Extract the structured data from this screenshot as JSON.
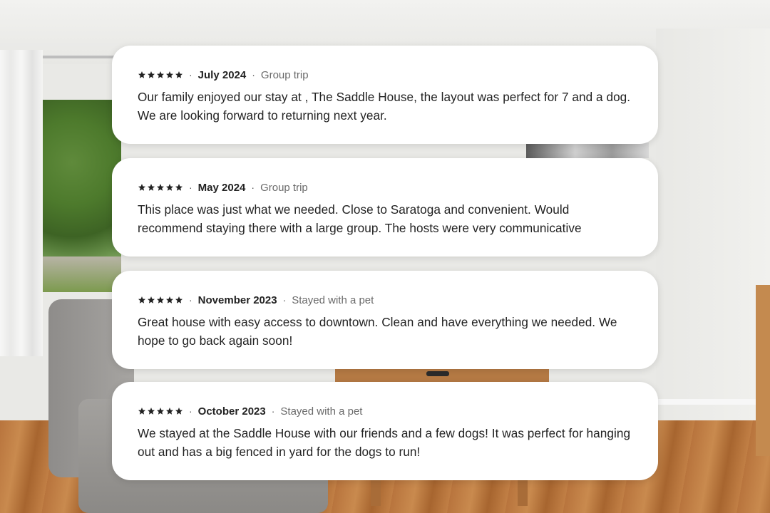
{
  "reviews": [
    {
      "rating": 5,
      "date": "July 2024",
      "trip_type": "Group trip",
      "text": "Our family enjoyed our stay at , The Saddle House, the layout was perfect for 7 and a dog. We are looking forward to returning next year."
    },
    {
      "rating": 5,
      "date": "May 2024",
      "trip_type": "Group trip",
      "text": "This place was just what we needed. Close to Saratoga and convenient. Would recommend staying there with a large group. The hosts were very communicative"
    },
    {
      "rating": 5,
      "date": "November 2023",
      "trip_type": "Stayed with a pet",
      "text": "Great house with easy access to downtown. Clean and have everything we needed. We hope to go back again soon!"
    },
    {
      "rating": 5,
      "date": "October 2023",
      "trip_type": "Stayed with a pet",
      "text": "We stayed at the Saddle House with our friends and a few dogs! It was perfect for hanging out and has a big fenced in yard for the dogs to run!"
    }
  ],
  "separator": "·",
  "star_color": "#222222"
}
